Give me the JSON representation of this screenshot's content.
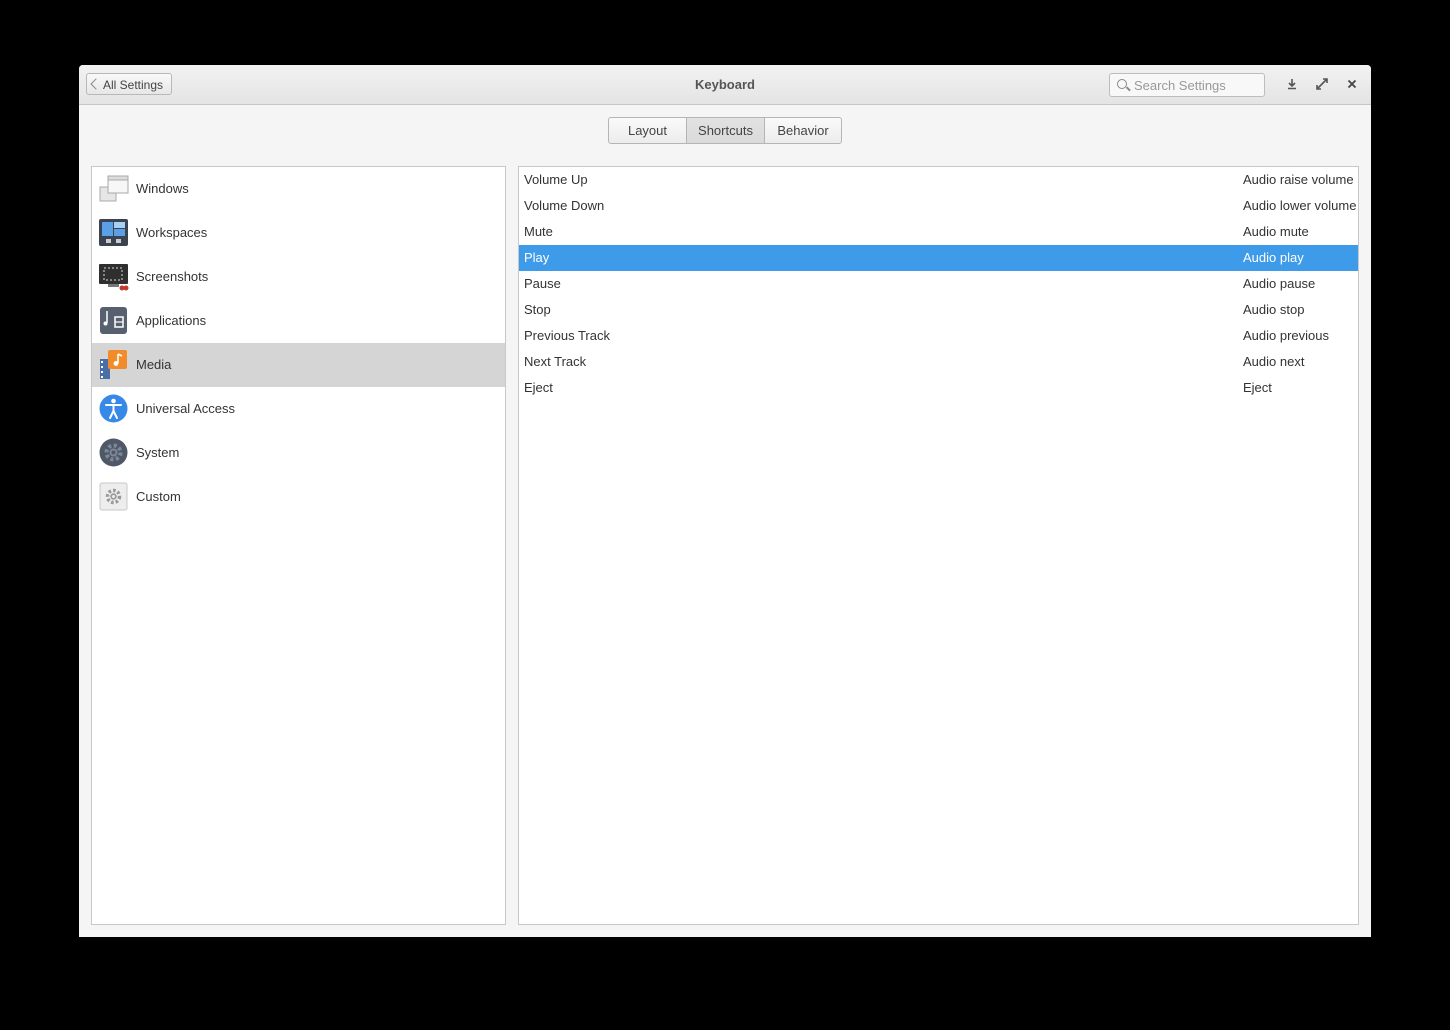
{
  "window": {
    "title": "Keyboard",
    "back_label": "All Settings",
    "search_placeholder": "Search Settings",
    "controls": [
      "download-icon",
      "maximize-icon",
      "close-icon"
    ]
  },
  "tabs": [
    {
      "label": "Layout",
      "active": false
    },
    {
      "label": "Shortcuts",
      "active": true
    },
    {
      "label": "Behavior",
      "active": false
    }
  ],
  "sidebar": {
    "items": [
      {
        "label": "Windows",
        "icon": "windows-icon"
      },
      {
        "label": "Workspaces",
        "icon": "workspaces-icon"
      },
      {
        "label": "Screenshots",
        "icon": "screenshots-icon"
      },
      {
        "label": "Applications",
        "icon": "applications-icon"
      },
      {
        "label": "Media",
        "icon": "media-icon",
        "selected": true
      },
      {
        "label": "Universal Access",
        "icon": "universal-access-icon"
      },
      {
        "label": "System",
        "icon": "system-icon"
      },
      {
        "label": "Custom",
        "icon": "custom-icon"
      }
    ]
  },
  "shortcuts": [
    {
      "name": "Volume Up",
      "accel": "Audio raise volume"
    },
    {
      "name": "Volume Down",
      "accel": "Audio lower volume"
    },
    {
      "name": "Mute",
      "accel": "Audio mute"
    },
    {
      "name": "Play",
      "accel": "Audio play",
      "selected": true
    },
    {
      "name": "Pause",
      "accel": "Audio pause"
    },
    {
      "name": "Stop",
      "accel": "Audio stop"
    },
    {
      "name": "Previous Track",
      "accel": "Audio previous"
    },
    {
      "name": "Next Track",
      "accel": "Audio next"
    },
    {
      "name": "Eject",
      "accel": "Eject"
    }
  ],
  "colors": {
    "selection": "#3d9be9",
    "sidebar_selection": "#d5d5d5"
  }
}
